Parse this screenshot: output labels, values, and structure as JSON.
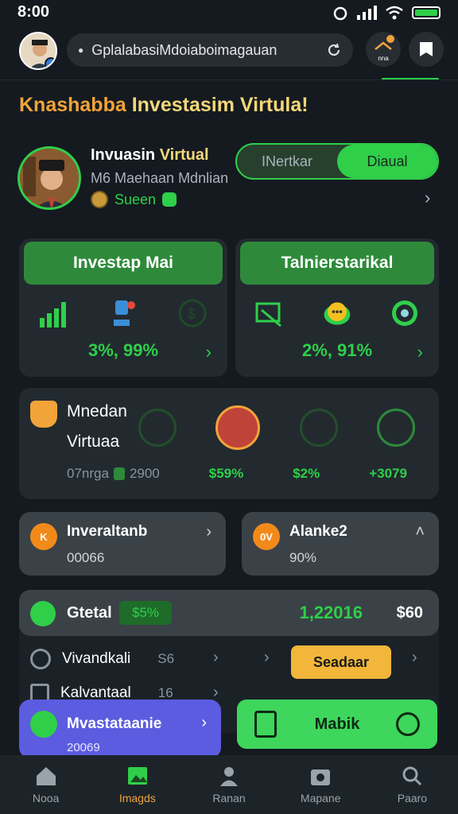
{
  "status_bar": {
    "time": "8:00"
  },
  "header": {
    "search_text": "GplalabasiMdoiaboimagauan",
    "notification_label": "nna"
  },
  "title": {
    "part1": "Knashabba",
    "part2": "Investasim Virtula!"
  },
  "profile": {
    "name_part1": "Invuasin",
    "name_part2": "Virtual",
    "subtitle": "M6 Maehaan Mdnlian",
    "status": "Sueen"
  },
  "toggle": {
    "option1": "INertkar",
    "option2": "Diaual"
  },
  "cards": [
    {
      "title": "Investap Mai",
      "value": "3%, 99%"
    },
    {
      "title": "Talnierstarikal",
      "value": "2%, 91%"
    }
  ],
  "wide_card": {
    "title_line1": "Mnedan",
    "title_line2": "Virtuaa",
    "footer_left": "07nrga",
    "footer_num": "2900",
    "stat1": "$59%",
    "stat2": "$2%",
    "stat3": "+3079"
  },
  "small_cards": [
    {
      "icon_text": "K",
      "title": "Inveraltanb",
      "sub": "00066"
    },
    {
      "icon_text": "0V",
      "title": "Alanke2",
      "sub": "90%"
    }
  ],
  "total": {
    "label": "Gtetal",
    "badge": "$5%",
    "value": "1,22016",
    "currency": "$60",
    "rows": [
      {
        "label": "Vivandkali",
        "amount": "S6"
      },
      {
        "label": "Kalvantaal",
        "amount": "16"
      }
    ],
    "gold_button": "Seadaar"
  },
  "floating": {
    "purple_label": "Mvastataanie",
    "purple_sub": "20069",
    "green_label": "Mabik"
  },
  "nav": [
    {
      "label": "Nooa"
    },
    {
      "label": "Imagds"
    },
    {
      "label": "Ranan"
    },
    {
      "label": "Mapane"
    },
    {
      "label": "Paaro"
    }
  ],
  "colors": {
    "accent_green": "#2fcf4a",
    "accent_orange": "#f2a33a",
    "background": "#141a1f"
  }
}
